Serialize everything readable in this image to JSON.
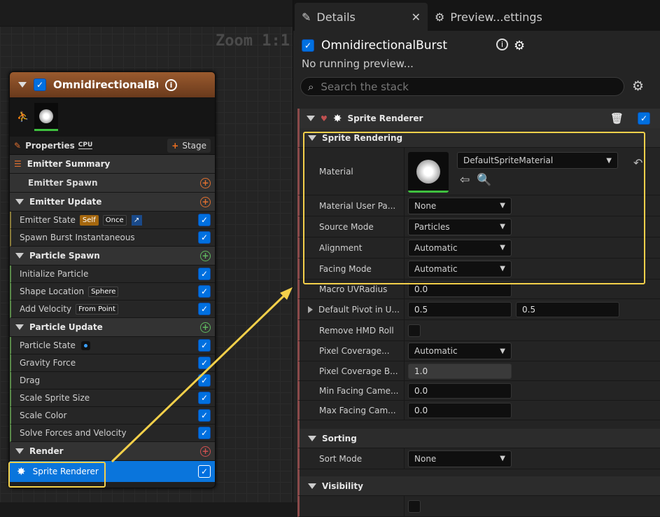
{
  "graph": {
    "zoom_label": "Zoom 1:1"
  },
  "node": {
    "title": "OmnidirectionalBurst",
    "properties_label": "Properties",
    "cpu_badge": "CPU",
    "stage_label": "Stage",
    "emitter_summary": "Emitter Summary",
    "emitter_spawn": "Emitter Spawn",
    "emitter_update": "Emitter Update",
    "emitter_state": "Emitter State",
    "emitter_state_tag1": "Self",
    "emitter_state_tag2": "Once",
    "spawn_burst": "Spawn Burst Instantaneous",
    "particle_spawn": "Particle Spawn",
    "initialize_particle": "Initialize Particle",
    "shape_location": "Shape Location",
    "shape_location_tag": "Sphere",
    "add_velocity": "Add Velocity",
    "add_velocity_tag": "From Point",
    "particle_update": "Particle Update",
    "particle_state": "Particle State",
    "gravity_force": "Gravity Force",
    "drag": "Drag",
    "scale_sprite_size": "Scale Sprite Size",
    "scale_color": "Scale Color",
    "solve_forces": "Solve Forces and Velocity",
    "render": "Render",
    "sprite_renderer": "Sprite Renderer"
  },
  "details": {
    "tab_details": "Details",
    "tab_preview": "Preview...ettings",
    "emitter_name": "OmnidirectionalBurst",
    "no_preview": "No running preview...",
    "search_placeholder": "Search the stack",
    "section_title": "Sprite Renderer",
    "cat_sprite_rendering": "Sprite Rendering",
    "material_label": "Material",
    "material_value": "DefaultSpriteMaterial",
    "material_user_param_label": "Material User Pa...",
    "material_user_param_value": "None",
    "source_mode_label": "Source Mode",
    "source_mode_value": "Particles",
    "alignment_label": "Alignment",
    "alignment_value": "Automatic",
    "facing_mode_label": "Facing Mode",
    "facing_mode_value": "Automatic",
    "macro_uv_label": "Macro UVRadius",
    "macro_uv_value": "0.0",
    "default_pivot_label": "Default Pivot in U...",
    "default_pivot_x": "0.5",
    "default_pivot_y": "0.5",
    "remove_hmd_label": "Remove HMD Roll",
    "pixel_cov_mode_label": "Pixel Coverage...",
    "pixel_cov_mode_value": "Automatic",
    "pixel_cov_b_label": "Pixel Coverage B...",
    "pixel_cov_b_value": "1.0",
    "min_facing_label": "Min Facing Came...",
    "min_facing_value": "0.0",
    "max_facing_label": "Max Facing Cam...",
    "max_facing_value": "0.0",
    "cat_sorting": "Sorting",
    "sort_mode_label": "Sort Mode",
    "sort_mode_value": "None",
    "cat_visibility": "Visibility"
  },
  "colors": {
    "highlight": "#f3d04a",
    "selection": "#0a75dc",
    "checkbox": "#0070e0",
    "node_header": "#9a5a2e"
  }
}
